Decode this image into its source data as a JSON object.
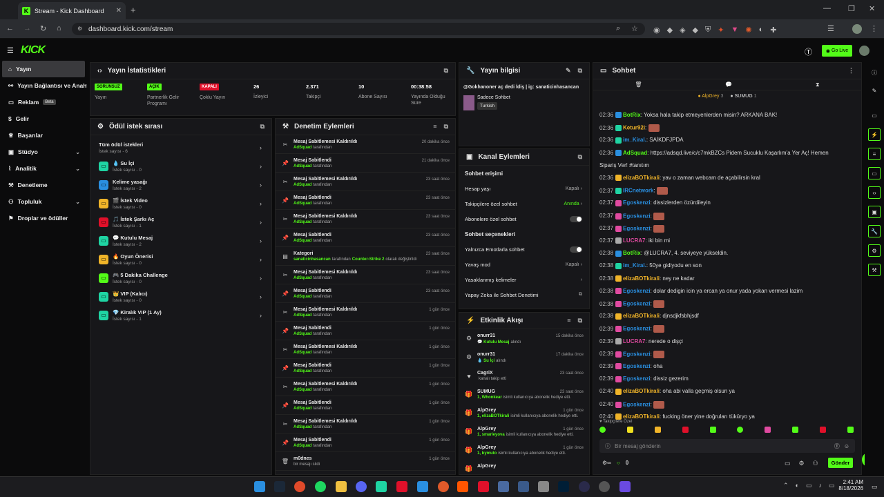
{
  "browser": {
    "tab_title": "Stream - Kick Dashboard",
    "url": "dashboard.kick.com/stream",
    "new_tab": "+"
  },
  "kick": {
    "logo": "KICK",
    "go_live": "Go Live"
  },
  "sidebar": {
    "items": [
      {
        "label": "Yayın",
        "active": true
      },
      {
        "label": "Yayın Bağlantısı ve Anahtarı"
      },
      {
        "label": "Reklam",
        "badge": "Beta"
      },
      {
        "label": "Gelir"
      },
      {
        "label": "Başarılar"
      },
      {
        "label": "Stüdyo",
        "expand": true
      },
      {
        "label": "Analitik",
        "expand": true
      },
      {
        "label": "Denetleme"
      },
      {
        "label": "Topluluk",
        "expand": true
      },
      {
        "label": "Droplar ve ödüller"
      }
    ]
  },
  "stats": {
    "title": "Yayın İstatistikleri",
    "items": [
      {
        "badge": "SORUNSUZ",
        "label": "Yayın",
        "color": "#53fc18"
      },
      {
        "badge": "AÇIK",
        "label": "Partnerlik Gelir Programı",
        "color": "#53fc18"
      },
      {
        "badge": "KAPALI",
        "label": "Çoklu Yayın",
        "color": "#e0102a"
      },
      {
        "value": "26",
        "label": "İzleyici"
      },
      {
        "value": "2.371",
        "label": "Takipçi"
      },
      {
        "value": "10",
        "label": "Abone Sayısı"
      },
      {
        "value": "00:38:58",
        "label": "Yayında Olduğu Süre"
      }
    ]
  },
  "streaminfo": {
    "title": "Yayın bilgisi",
    "stream_title": "@Gokhanoner aç dedi İdiş | ig: sanaticinhasancan",
    "category": "Sadece Sohbet",
    "tag": "Turkish"
  },
  "queue": {
    "title": "Ödül istek sırası",
    "items": [
      {
        "title": "Tüm ödül istekleri",
        "sub": "İstek sayısı - 6",
        "icon": ""
      },
      {
        "title": "💧 Su İçi",
        "sub": "İstek sayısı - 0",
        "color": "#1fd4a3"
      },
      {
        "title": "Kelime yasağı",
        "sub": "İstek sayısı - 2",
        "color": "#2a8fe0"
      },
      {
        "title": "🎬 İstek Video",
        "sub": "İstek sayısı - 0",
        "color": "#f0b429"
      },
      {
        "title": "🎵 İstek Şarkı Aç",
        "sub": "İstek sayısı - 1",
        "color": "#e0102a"
      },
      {
        "title": "💬 Kutulu Mesaj",
        "sub": "İstek sayısı - 2",
        "color": "#1fd4a3"
      },
      {
        "title": "🔥 Oyun Önerisi",
        "sub": "İstek sayısı - 0",
        "color": "#f0b429"
      },
      {
        "title": "🎮 5 Dakika Challenge",
        "sub": "İstek sayısı - 0",
        "color": "#53fc18"
      },
      {
        "title": "👑 VIP (Kalıcı)",
        "sub": "İstek sayısı - 0",
        "color": "#1fd4a3"
      },
      {
        "title": "💎 Kiralık VIP (1 Ay)",
        "sub": "İstek sayısı - 1",
        "color": "#1fd4a3"
      }
    ]
  },
  "moderation": {
    "title": "Denetim Eylemleri",
    "suffix": "tarafından",
    "items": [
      {
        "title": "Mesaj Sabitlemesi Kaldırıldı",
        "by": "AdSquad",
        "time": "20 dakika önce",
        "icon": "✂"
      },
      {
        "title": "Mesaj Sabitlendi",
        "by": "AdSquad",
        "time": "21 dakika önce",
        "icon": "📌"
      },
      {
        "title": "Mesaj Sabitlemesi Kaldırıldı",
        "by": "AdSquad",
        "time": "23 saat önce",
        "icon": "✂"
      },
      {
        "title": "Mesaj Sabitlendi",
        "by": "AdSquad",
        "time": "23 saat önce",
        "icon": "📌"
      },
      {
        "title": "Mesaj Sabitlemesi Kaldırıldı",
        "by": "AdSquad",
        "time": "23 saat önce",
        "icon": "✂"
      },
      {
        "title": "Mesaj Sabitlendi",
        "by": "AdSquad",
        "time": "23 saat önce",
        "icon": "📌"
      },
      {
        "title": "Kategori",
        "by": "sanaticinhasancan",
        "extra": "Counter-Strike 2",
        "extra_suffix": "olarak değiştirildi",
        "time": "23 saat önce",
        "icon": "▤"
      },
      {
        "title": "Mesaj Sabitlemesi Kaldırıldı",
        "by": "AdSquad",
        "time": "23 saat önce",
        "icon": "✂"
      },
      {
        "title": "Mesaj Sabitlendi",
        "by": "AdSquad",
        "time": "23 saat önce",
        "icon": "📌"
      },
      {
        "title": "Mesaj Sabitlemesi Kaldırıldı",
        "by": "AdSquad",
        "time": "1 gün önce",
        "icon": "✂"
      },
      {
        "title": "Mesaj Sabitlendi",
        "by": "AdSquad",
        "time": "1 gün önce",
        "icon": "📌"
      },
      {
        "title": "Mesaj Sabitlemesi Kaldırıldı",
        "by": "AdSquad",
        "time": "1 gün önce",
        "icon": "✂"
      },
      {
        "title": "Mesaj Sabitlendi",
        "by": "AdSquad",
        "time": "1 gün önce",
        "icon": "📌"
      },
      {
        "title": "Mesaj Sabitlemesi Kaldırıldı",
        "by": "AdSquad",
        "time": "1 gün önce",
        "icon": "✂"
      },
      {
        "title": "Mesaj Sabitlendi",
        "by": "AdSquad",
        "time": "1 gün önce",
        "icon": "📌"
      },
      {
        "title": "Mesaj Sabitlemesi Kaldırıldı",
        "by": "AdSquad",
        "time": "1 gün önce",
        "icon": "✂"
      },
      {
        "title": "Mesaj Sabitlendi",
        "by": "AdSquad",
        "time": "1 gün önce",
        "icon": "📌"
      },
      {
        "title": "m0dnes",
        "sub": "bir mesajı sildi",
        "time": "1 gün önce",
        "icon": "🗑"
      }
    ]
  },
  "channel": {
    "title": "Kanal Eylemleri",
    "chat_access": "Sohbet erişimi",
    "account_age": "Hesap yaşı",
    "account_age_val": "Kapalı",
    "followers_only": "Takipçilere özel sohbet",
    "followers_only_val": "Anında",
    "subs_only": "Abonelere özel sohbet",
    "chat_options": "Sohbet seçenekleri",
    "emotes_only": "Yalnızca Emotlarla sohbet",
    "slow_mode": "Yavaş mod",
    "slow_mode_val": "Kapalı",
    "banned_words": "Yasaklanmış kelimeler",
    "ai_mod": "Yapay Zeka ile Sohbet Denetimi"
  },
  "activity": {
    "title": "Etkinlik Akışı",
    "items": [
      {
        "name": "onurr31",
        "sub": "💬 Kutulu Mesaj",
        "sub2": "alındı",
        "time": "15 dakika önce",
        "icon": "⚙"
      },
      {
        "name": "onurr31",
        "sub": "💧 Su İçi",
        "sub2": "alındı",
        "time": "17 dakika önce",
        "icon": "⚙"
      },
      {
        "name": "CagriX",
        "sub": "",
        "sub2": "kanalı takip etti",
        "time": "23 saat önce",
        "icon": "♥"
      },
      {
        "name": "SUMUG",
        "sub": "1, Whonkear",
        "sub2": "isimli kullanıcıya abonelik hediye etti.",
        "time": "23 saat önce",
        "icon": "🎁"
      },
      {
        "name": "AlpGrey",
        "sub": "1, elizaBOTkirali",
        "sub2": "isimli kullanıcıya abonelik hediye etti.",
        "time": "1 gün önce",
        "icon": "🎁"
      },
      {
        "name": "AlpGrey",
        "sub": "1, smarleyova",
        "sub2": "isimli kullanıcıya abonelik hediye etti.",
        "time": "1 gün önce",
        "icon": "🎁"
      },
      {
        "name": "AlpGrey",
        "sub": "1, bymuto",
        "sub2": "isimli kullanıcıya abonelik hediye etti.",
        "time": "1 gün önce",
        "icon": "🎁"
      },
      {
        "name": "AlpGrey",
        "sub": "",
        "sub2": "",
        "time": "",
        "icon": "🎁"
      }
    ]
  },
  "chat": {
    "title": "Sohbet",
    "gifters": [
      {
        "name": "AlpGrey",
        "count": "3"
      },
      {
        "name": "SUMUG",
        "count": "1"
      }
    ],
    "followers_label": "Takipçilere Özel",
    "input_placeholder": "Bir mesaj gönderin",
    "send": "Gönder",
    "counter": "0",
    "messages": [
      {
        "t": "02:36",
        "u": "BotRix",
        "c": "#53fc18",
        "m": "Yoksa hala takip etmeyenlerden misin? ARKANA BAK!",
        "b": "#2a8fe0"
      },
      {
        "t": "02:36",
        "u": "Ketur92i",
        "c": "#f0b429",
        "m": "",
        "e": true,
        "b": "#1fd4a3"
      },
      {
        "t": "02:36",
        "u": "im_Kiral.",
        "c": "#2a8fe0",
        "m": "SAİKDFJPDA",
        "b": "#1fd4a3"
      },
      {
        "t": "02:36",
        "u": "AdSquad",
        "c": "#53fc18",
        "m": "https://adsqd.live/c/c7mkBZCs Pidem Sucuklu Kaşarlım'a Yer Aç! Hemen",
        "b": "#2a8fe0"
      },
      {
        "t": "",
        "u": "",
        "c": "#fff",
        "m": "Sipariş Ver! #tanıtım"
      },
      {
        "t": "02:36",
        "u": "elizaBOTkirali",
        "c": "#f0b429",
        "m": "yav o zaman webcam de açabilirsin kral",
        "b": "#f0b429"
      },
      {
        "t": "02:37",
        "u": "IRCnetwork",
        "c": "#2a8fe0",
        "m": "",
        "e": true,
        "b": "#1fd4a3"
      },
      {
        "t": "02:37",
        "u": "Egoskenzi",
        "c": "#2a8fe0",
        "m": "dissizlerden özürdileyin",
        "b": "#e04aa0"
      },
      {
        "t": "02:37",
        "u": "Egoskenzi",
        "c": "#2a8fe0",
        "m": "",
        "e": true,
        "b": "#e04aa0"
      },
      {
        "t": "02:37",
        "u": "Egoskenzi",
        "c": "#2a8fe0",
        "m": "",
        "e": true,
        "b": "#e04aa0"
      },
      {
        "t": "02:37",
        "u": "LUCRA7",
        "c": "#e04aa0",
        "m": "iki bin mi",
        "b": "#aaa"
      },
      {
        "t": "02:38",
        "u": "BotRix",
        "c": "#53fc18",
        "m": "@LUCRA7, 4. seviyeye yükseldin.",
        "b": "#2a8fe0"
      },
      {
        "t": "02:38",
        "u": "im_Kiral.",
        "c": "#2a8fe0",
        "m": "50ye gidiyodu en son",
        "b": "#1fd4a3"
      },
      {
        "t": "02:38",
        "u": "elizaBOTkirali",
        "c": "#f0b429",
        "m": "ney ne kadar",
        "b": "#f0b429"
      },
      {
        "t": "02:38",
        "u": "Egoskenzi",
        "c": "#2a8fe0",
        "m": "dolar dedigin icin ya ercan ya onur yada yokan vermesi lazim",
        "b": "#e04aa0"
      },
      {
        "t": "02:38",
        "u": "Egoskenzi",
        "c": "#2a8fe0",
        "m": "",
        "e": true,
        "b": "#e04aa0"
      },
      {
        "t": "02:38",
        "u": "elizaBOTkirali",
        "c": "#f0b429",
        "m": "djnsdjkfsbhjsdf",
        "b": "#f0b429"
      },
      {
        "t": "02:39",
        "u": "Egoskenzi",
        "c": "#2a8fe0",
        "m": "",
        "e": true,
        "b": "#e04aa0"
      },
      {
        "t": "02:39",
        "u": "LUCRA7",
        "c": "#e04aa0",
        "m": "nerede o dişçi",
        "b": "#aaa"
      },
      {
        "t": "02:39",
        "u": "Egoskenzi",
        "c": "#2a8fe0",
        "m": "",
        "e": true,
        "b": "#e04aa0"
      },
      {
        "t": "02:39",
        "u": "Egoskenzi",
        "c": "#2a8fe0",
        "m": "oha",
        "b": "#e04aa0"
      },
      {
        "t": "02:39",
        "u": "Egoskenzi",
        "c": "#2a8fe0",
        "m": "dissiz gezerim",
        "b": "#e04aa0"
      },
      {
        "t": "02:40",
        "u": "elizaBOTkirali",
        "c": "#f0b429",
        "m": "oha abi valla geçmiş olsun ya",
        "b": "#f0b429"
      },
      {
        "t": "02:40",
        "u": "Egoskenzi",
        "c": "#2a8fe0",
        "m": "",
        "e": true,
        "b": "#e04aa0"
      },
      {
        "t": "02:40",
        "u": "elizaBOTkirali",
        "c": "#f0b429",
        "m": "fucking öner yine doğruları tüküryo ya",
        "b": "#f0b429"
      }
    ]
  },
  "taskbar": {
    "time": "2:41 AM",
    "date": "8/18/2026"
  }
}
